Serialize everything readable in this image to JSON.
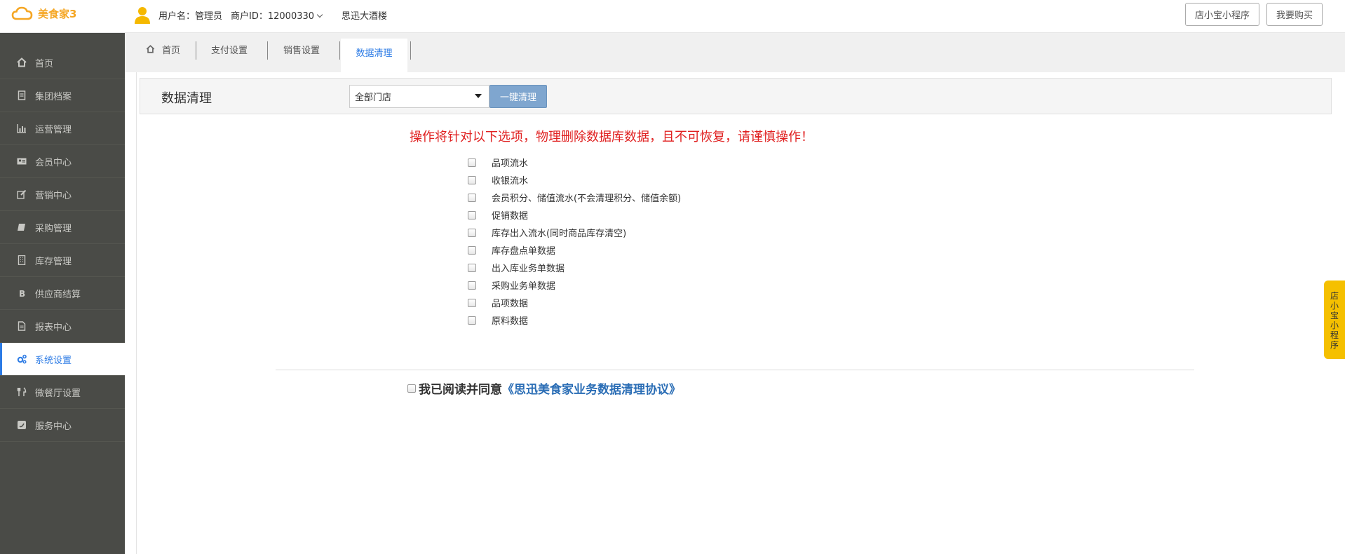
{
  "header": {
    "logo_text": "美食家3",
    "username": "用户名：管理员",
    "merchant_id": "商户ID：12000330",
    "store_name": "思迅大酒楼",
    "btn_mini_program": "店小宝小程序",
    "btn_buy": "我要购买"
  },
  "sidebar": {
    "items": [
      {
        "label": "首页",
        "icon": "home-icon"
      },
      {
        "label": "集团档案",
        "icon": "file-icon"
      },
      {
        "label": "运营管理",
        "icon": "bar-chart-icon"
      },
      {
        "label": "会员中心",
        "icon": "id-card-icon"
      },
      {
        "label": "营销中心",
        "icon": "edit-icon"
      },
      {
        "label": "采购管理",
        "icon": "book-icon"
      },
      {
        "label": "库存管理",
        "icon": "building-icon"
      },
      {
        "label": "供应商结算",
        "icon": "bitcoin-icon"
      },
      {
        "label": "报表中心",
        "icon": "document-icon"
      },
      {
        "label": "系统设置",
        "icon": "gears-icon",
        "active": true
      },
      {
        "label": "微餐厅设置",
        "icon": "cutlery-icon"
      },
      {
        "label": "服务中心",
        "icon": "twitter-square-icon"
      }
    ]
  },
  "tabs": {
    "home": "首页",
    "payment": "支付设置",
    "sales": "销售设置",
    "data_clean": "数据清理"
  },
  "toolbar": {
    "title": "数据清理",
    "store_select": "全部门店",
    "clear_button": "一键清理"
  },
  "warning": "操作将针对以下选项，物理删除数据库数据，且不可恢复，请谨慎操作！",
  "options": [
    "品项流水",
    "收银流水",
    "会员积分、储值流水(不会清理积分、储值余额)",
    "促销数据",
    "库存出入流水(同时商品库存清空)",
    "库存盘点单数据",
    "出入库业务单数据",
    "采购业务单数据",
    "品项数据",
    "原料数据"
  ],
  "agreement": {
    "prefix": "我已阅读并同意",
    "link": "《思迅美食家业务数据清理协议》"
  },
  "float_tab": [
    "店",
    "小",
    "宝",
    "小",
    "程",
    "序"
  ],
  "colors": {
    "sidebar_bg": "#4a4b47",
    "accent": "#2c7be5",
    "warning": "#e02020",
    "logo": "#f5a623",
    "float_tab": "#f5c000"
  }
}
